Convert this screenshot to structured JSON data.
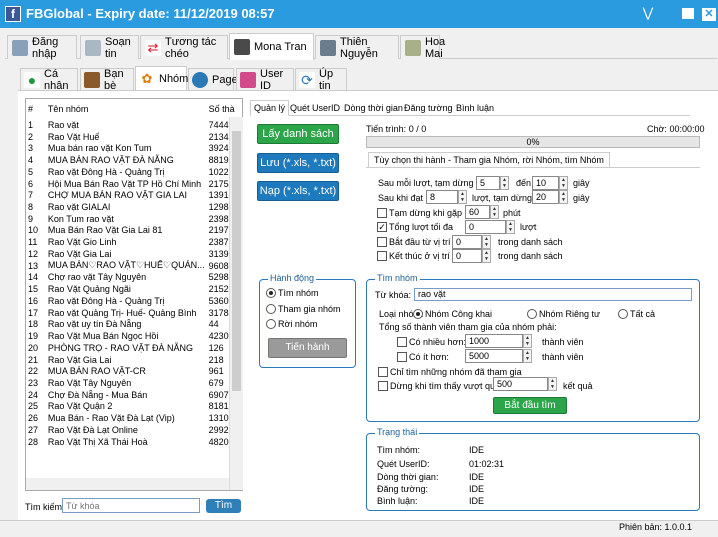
{
  "window": {
    "title": "FBGlobal - Expiry date: 11/12/2019 08:57",
    "app_icon_letter": "f",
    "icons": {
      "collapse": "chevrons-down-icon",
      "minimize": "minimize-icon",
      "close": "close-icon"
    }
  },
  "account_tabs": [
    {
      "label": "Đăng nhập",
      "icon": "login-icon"
    },
    {
      "label": "Soạn tin",
      "icon": "compose-icon"
    },
    {
      "label": "Tương tác chéo",
      "icon": "shuffle-icon"
    },
    {
      "label": "Mona Tran",
      "icon": "avatar-icon"
    },
    {
      "label": "Thiên Nguyễn",
      "icon": "avatar-icon"
    },
    {
      "label": "Hoa Mai",
      "icon": "avatar-icon"
    }
  ],
  "function_tabs": [
    {
      "label": "Cá nhân",
      "icon": "user-icon"
    },
    {
      "label": "Bạn bè",
      "icon": "friends-icon"
    },
    {
      "label": "Nhóm",
      "icon": "group-icon"
    },
    {
      "label": "Page",
      "icon": "flag-icon"
    },
    {
      "label": "User ID",
      "icon": "id-card-icon"
    },
    {
      "label": "Úp tin",
      "icon": "refresh-icon"
    }
  ],
  "group_list": {
    "headers": [
      "#",
      "Tên nhóm",
      "Số thà"
    ],
    "rows": [
      [
        "1",
        "Rao vặt",
        "74445"
      ],
      [
        "2",
        "Rao Vặt Huế",
        "21345"
      ],
      [
        "3",
        "Mua bán rao vặt Kon Tum",
        "3924"
      ],
      [
        "4",
        "MUA BÁN RAO VẶT ĐÀ NẴNG",
        "8819"
      ],
      [
        "5",
        "Rao vặt Đông Hà - Quảng Trị",
        "10227"
      ],
      [
        "6",
        "Hội Mua Bán Rao Vặt TP Hồ Chí Minh",
        "21754"
      ],
      [
        "7",
        "CHỢ MUA BÁN RAO VẶT GIA LAI",
        "13919"
      ],
      [
        "8",
        "Rao vặt GIALAI",
        "1298"
      ],
      [
        "9",
        "Kon Tum rao vặt",
        "23988"
      ],
      [
        "10",
        "Mua Bán Rao Vặt Gia Lai 81",
        "21977"
      ],
      [
        "11",
        "Rao Vặt Gio Linh",
        "23877"
      ],
      [
        "12",
        "Rao Vặt Gia Lai",
        "31392"
      ],
      [
        "13",
        "MUA BÁN♡RAO VẶT♡HUẾ♡QUẢN...",
        "9608"
      ],
      [
        "14",
        "Chợ rao vặt Tây Nguyên",
        "52981"
      ],
      [
        "15",
        "Rao Vặt Quảng Ngãi",
        "21522"
      ],
      [
        "16",
        "Rao vặt Đông Hà - Quảng Trị",
        "53601"
      ],
      [
        "17",
        "Rao vặt Quảng Trị- Huế- Quảng Bình",
        "31780"
      ],
      [
        "18",
        "Rao vặt uy tín Đà Nẵng",
        "44"
      ],
      [
        "19",
        "Rao Vặt Mua Bán Ngọc Hồi",
        "4230"
      ],
      [
        "20",
        "PHÒNG TRỌ - RAO VẶT ĐÀ NẴNG",
        "126"
      ],
      [
        "21",
        "Rao Vặt Gia Lai",
        "218"
      ],
      [
        "22",
        "MUA BÁN RAO VẶT-CR",
        "961"
      ],
      [
        "23",
        "Rao Vặt Tây Nguyên",
        "679"
      ],
      [
        "24",
        "Chợ Đà Nẵng - Mua Bán",
        "69075"
      ],
      [
        "25",
        "Rao Vặt Quận 2",
        "8181"
      ],
      [
        "26",
        "Mua Bán - Rao Vặt Đà Lạt (Vip)",
        "13101"
      ],
      [
        "27",
        "Rao Vặt Đà Lạt Online",
        "29922"
      ],
      [
        "28",
        "Rao Vặt Thị Xã Thái Hoà",
        "48208"
      ]
    ]
  },
  "search": {
    "label": "Tìm kiếm:",
    "placeholder": "Từ khóa",
    "button": "Tìm"
  },
  "sub_tabs": [
    "Quản lý",
    "Quét UserID",
    "Dòng thời gian",
    "Đăng tường",
    "Bình luận"
  ],
  "actions": {
    "get_list": "Lấy danh sách",
    "save": "Lưu (*.xls, *.txt)",
    "load": "Nạp (*.xls, *.txt)"
  },
  "progress": {
    "label": "Tiến trình:",
    "value_text": "0 / 0",
    "time_label": "Chờ:",
    "time_value": "00:00:00",
    "percent_text": "0%",
    "percent": 0
  },
  "run_options": {
    "tab_label": "Tùy chọn thi hành - Tham gia Nhóm, rời Nhóm, tìm Nhóm",
    "after_each_label": "Sau mỗi lượt, tạm dừng từ",
    "after_each_from": "5",
    "to_label": "đến",
    "after_each_to": "10",
    "seconds": "giây",
    "after_n_label": "Sau khi đạt",
    "after_n_value": "8",
    "after_n_mid": "lượt, tạm dừng",
    "after_n_pause": "20",
    "pause_on_error_label": "Tạm dừng khi gặp lỗi",
    "pause_on_error_checked": false,
    "pause_on_error_value": "60",
    "minutes": "phút",
    "max_turns_label": "Tổng lượt tối đa",
    "max_turns_checked": true,
    "max_turns_value": "0",
    "turns": "lượt",
    "start_from_label": "Bắt đầu từ vị trí",
    "start_from_checked": false,
    "start_from_value": "0",
    "end_at_label": "Kết thúc ở vị trí",
    "end_at_checked": false,
    "end_at_value": "0",
    "in_list": "trong danh sách"
  },
  "action_group": {
    "title": "Hành động",
    "options": [
      "Tìm nhóm",
      "Tham gia nhóm",
      "Rời nhóm"
    ],
    "selected": 0,
    "run_button": "Tiến hành"
  },
  "find_group": {
    "title": "Tìm nhóm",
    "keyword_label": "Từ khóa:",
    "keyword_value": "rao vặt",
    "type_label": "Loại nhóm:",
    "types": [
      "Nhóm Công khai",
      "Nhóm Riêng tư",
      "Tất cả"
    ],
    "type_selected": 0,
    "members_label": "Tổng số thành viên tham gia của nhóm phải:",
    "more_than_label": "Có nhiều hơn:",
    "more_than_checked": false,
    "more_than_value": "1000",
    "less_than_label": "Có ít hơn:",
    "less_than_checked": false,
    "less_than_value": "5000",
    "members_unit": "thành viên",
    "only_joined_label": "Chỉ tìm những nhóm đã tham gia",
    "only_joined_checked": false,
    "stop_when_label": "Dừng khi tìm thấy vượt quá",
    "stop_when_checked": false,
    "stop_when_value": "500",
    "results_unit": "kết quả",
    "start_button": "Bắt đầu tìm"
  },
  "status_group": {
    "title": "Trạng thái",
    "rows": [
      {
        "label": "Tìm nhóm:",
        "value": "IDE"
      },
      {
        "label": "Quét UserID:",
        "value": "01:02:31"
      },
      {
        "label": "Dòng thời gian:",
        "value": "IDE"
      },
      {
        "label": "Đăng tường:",
        "value": "IDE"
      },
      {
        "label": "Bình luận:",
        "value": "IDE"
      }
    ]
  },
  "footer": {
    "version": "Phiên bản: 1.0.0.1"
  },
  "colors": {
    "titlebar": "#2b9be0",
    "green_button": "#2ca54a",
    "blue_button": "#1d7bbd",
    "groupbox_border": "#2a7ab8"
  }
}
